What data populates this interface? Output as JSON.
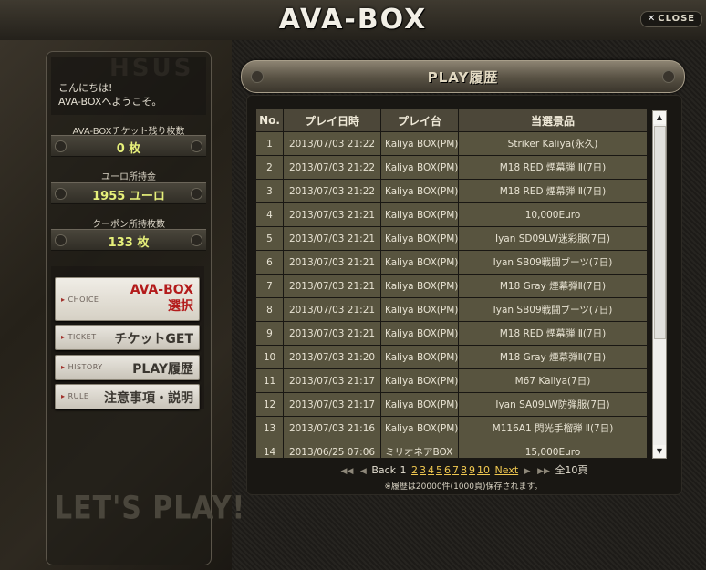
{
  "window": {
    "title": "AVA-BOX",
    "close_label": "CLOSE"
  },
  "sidebar": {
    "greeting_line1": "こんにちは!",
    "greeting_line2": "AVA-BOXへようこそ。",
    "decor_text": "HSUS",
    "stats": [
      {
        "label": "AVA-BOXチケット残り枚数",
        "value": "0 枚"
      },
      {
        "label": "ユーロ所持金",
        "value": "1955 ユーロ"
      },
      {
        "label": "クーポン所持枚数",
        "value": "133 枚"
      }
    ],
    "menu": [
      {
        "tag": "CHOICE",
        "main_line1": "AVA-BOX",
        "main_line2": "選択",
        "active": true
      },
      {
        "tag": "TICKET",
        "main_line1": "チケットGET"
      },
      {
        "tag": "HISTORY",
        "main_line1": "PLAY履歴"
      },
      {
        "tag": "RULE",
        "main_line1": "注意事項・説明"
      }
    ],
    "footer_text": "LET'S PLAY!"
  },
  "main": {
    "section_title": "PLAY履歴",
    "table": {
      "headers": [
        "No.",
        "プレイ日時",
        "プレイ台",
        "当選景品"
      ],
      "rows": [
        [
          "1",
          "2013/07/03 21:22",
          "Kaliya BOX(PM)",
          "Striker Kaliya(永久)"
        ],
        [
          "2",
          "2013/07/03 21:22",
          "Kaliya BOX(PM)",
          "M18 RED 煙幕弾 Ⅱ(7日)"
        ],
        [
          "3",
          "2013/07/03 21:22",
          "Kaliya BOX(PM)",
          "M18 RED 煙幕弾 Ⅱ(7日)"
        ],
        [
          "4",
          "2013/07/03 21:21",
          "Kaliya BOX(PM)",
          "10,000Euro"
        ],
        [
          "5",
          "2013/07/03 21:21",
          "Kaliya BOX(PM)",
          "Iyan SD09LW迷彩服(7日)"
        ],
        [
          "6",
          "2013/07/03 21:21",
          "Kaliya BOX(PM)",
          "Iyan SB09戦闘ブーツ(7日)"
        ],
        [
          "7",
          "2013/07/03 21:21",
          "Kaliya BOX(PM)",
          "M18 Gray 煙幕弾Ⅱ(7日)"
        ],
        [
          "8",
          "2013/07/03 21:21",
          "Kaliya BOX(PM)",
          "Iyan SB09戦闘ブーツ(7日)"
        ],
        [
          "9",
          "2013/07/03 21:21",
          "Kaliya BOX(PM)",
          "M18 RED 煙幕弾 Ⅱ(7日)"
        ],
        [
          "10",
          "2013/07/03 21:20",
          "Kaliya BOX(PM)",
          "M18 Gray 煙幕弾Ⅱ(7日)"
        ],
        [
          "11",
          "2013/07/03 21:17",
          "Kaliya BOX(PM)",
          "M67 Kaliya(7日)"
        ],
        [
          "12",
          "2013/07/03 21:17",
          "Kaliya BOX(PM)",
          "Iyan SA09LW防弾服(7日)"
        ],
        [
          "13",
          "2013/07/03 21:16",
          "Kaliya BOX(PM)",
          "M116A1 閃光手榴弾 Ⅱ(7日)"
        ],
        [
          "14",
          "2013/06/25 07:06",
          "ミリオネアBOX",
          "15,000Euro"
        ]
      ]
    },
    "pager": {
      "back_label": "Back",
      "current_page": "1",
      "pages": [
        "2",
        "3",
        "4",
        "5",
        "6",
        "7",
        "8",
        "9",
        "10"
      ],
      "next_label": "Next",
      "total_label": "全10頁"
    },
    "note": "※履歴は20000件(1000頁)保存されます。"
  },
  "colors": {
    "accent_red": "#b31b1b",
    "value_yellow": "#e6f07a",
    "link_gold": "#f0c850"
  }
}
